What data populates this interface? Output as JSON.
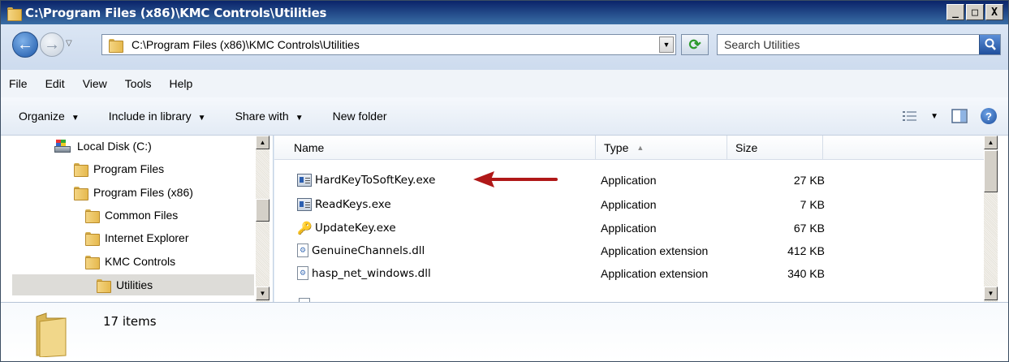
{
  "window": {
    "title": "C:\\Program Files (x86)\\KMC Controls\\Utilities",
    "controls": [
      "_",
      "□",
      "X"
    ]
  },
  "address_bar": {
    "path": "C:\\Program Files (x86)\\KMC Controls\\Utilities",
    "search_placeholder": "Search Utilities"
  },
  "menu": [
    "File",
    "Edit",
    "View",
    "Tools",
    "Help"
  ],
  "commands": [
    {
      "label": "Organize",
      "has_dropdown": true
    },
    {
      "label": "Include in library",
      "has_dropdown": true
    },
    {
      "label": "Share with",
      "has_dropdown": true
    },
    {
      "label": "New folder",
      "has_dropdown": false
    }
  ],
  "nav_tree": [
    {
      "label": "Local Disk (C:)",
      "icon": "drive-icon"
    },
    {
      "label": "Program Files",
      "icon": "folder-icon"
    },
    {
      "label": "Program Files (x86)",
      "icon": "folder-icon"
    },
    {
      "label": "Common Files",
      "icon": "folder-icon"
    },
    {
      "label": "Internet Explorer",
      "icon": "folder-icon"
    },
    {
      "label": "KMC Controls",
      "icon": "folder-icon"
    },
    {
      "label": "Utilities",
      "icon": "folder-icon",
      "selected": true
    }
  ],
  "columns": {
    "name": "Name",
    "type": "Type",
    "size": "Size"
  },
  "files": [
    {
      "name": "HardKeyToSoftKey.exe",
      "type": "Application",
      "size": "27 KB",
      "icon": "exe-icon"
    },
    {
      "name": "ReadKeys.exe",
      "type": "Application",
      "size": "7 KB",
      "icon": "exe-icon"
    },
    {
      "name": "UpdateKey.exe",
      "type": "Application",
      "size": "67 KB",
      "icon": "key-icon"
    },
    {
      "name": "GenuineChannels.dll",
      "type": "Application extension",
      "size": "412 KB",
      "icon": "dll-icon"
    },
    {
      "name": "hasp_net_windows.dll",
      "type": "Application extension",
      "size": "340 KB",
      "icon": "dll-icon"
    }
  ],
  "status": {
    "item_count": "17 items"
  },
  "colors": {
    "annotation_arrow": "#b01818",
    "selection": "#dddcd8"
  }
}
